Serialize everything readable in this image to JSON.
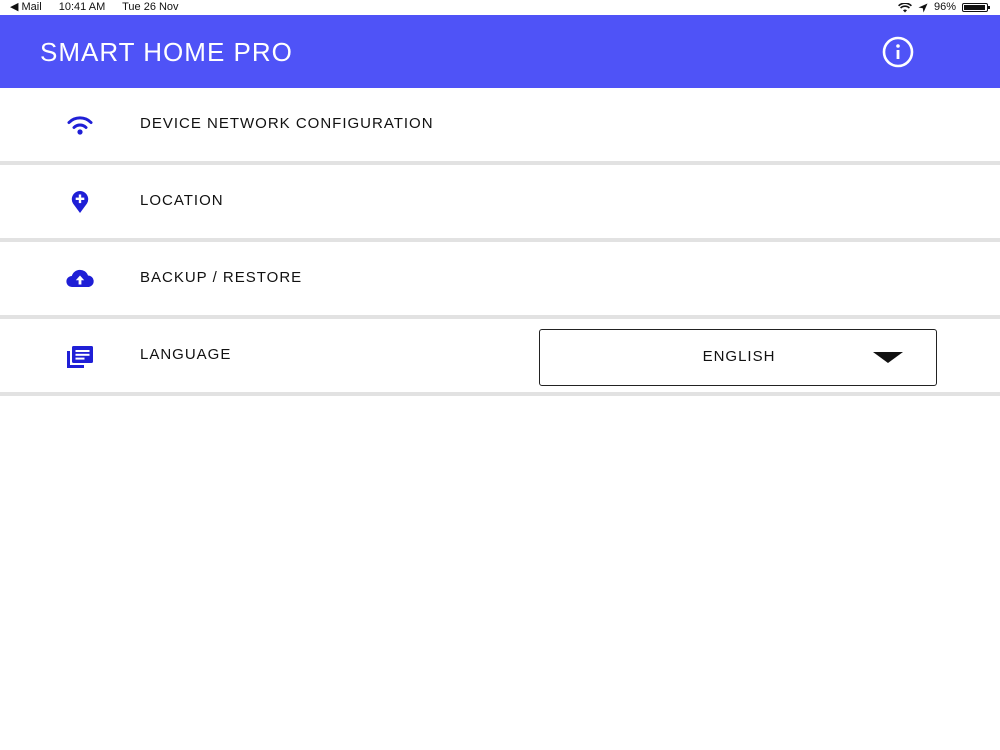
{
  "status_bar": {
    "back_app": "◀ Mail",
    "time": "10:41 AM",
    "date": "Tue 26 Nov",
    "battery": "96%",
    "battery_level": 0.96
  },
  "app_bar": {
    "title": "SMART HOME PRO",
    "info_icon": "info-icon",
    "color": "#4f53f7"
  },
  "settings": {
    "items": [
      {
        "label": "DEVICE NETWORK CONFIGURATION",
        "icon": "wifi-icon"
      },
      {
        "label": "LOCATION",
        "icon": "location-pin-icon"
      },
      {
        "label": "BACKUP / RESTORE",
        "icon": "cloud-upload-icon"
      },
      {
        "label": "LANGUAGE",
        "icon": "library-books-icon"
      }
    ],
    "language_select": {
      "selected": "ENGLISH"
    }
  },
  "colors": {
    "accent": "#4f53f7",
    "icon": "#1f1fd6",
    "divider": "#e2e2e2"
  }
}
